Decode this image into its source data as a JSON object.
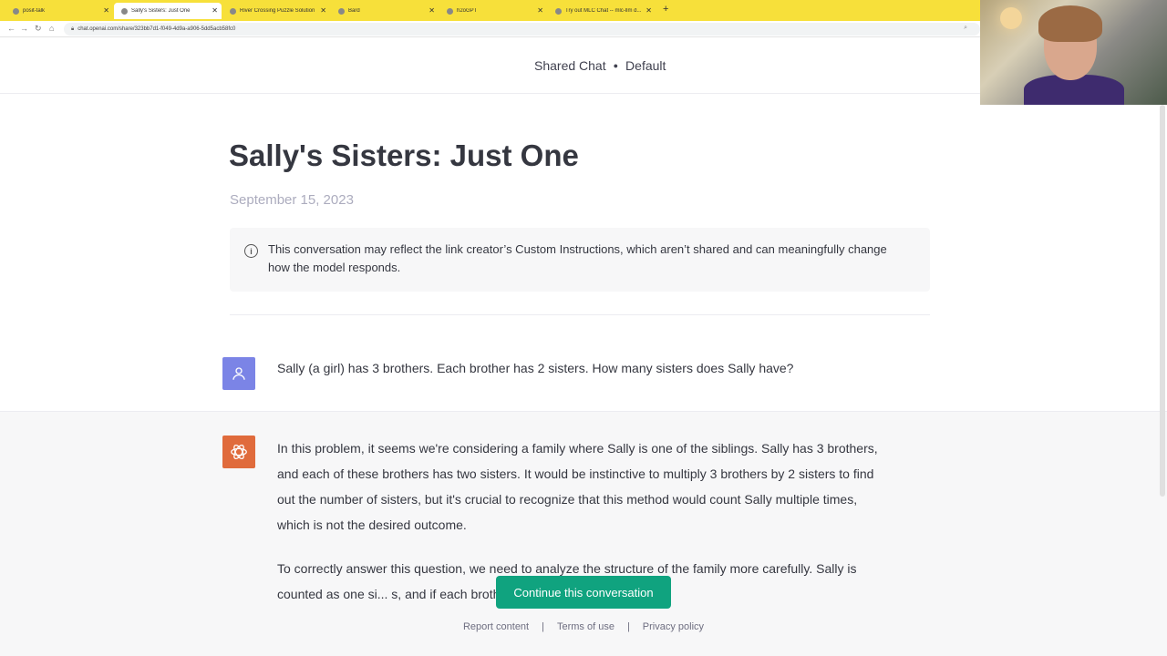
{
  "browser": {
    "tabs": [
      {
        "title": "posit-talk"
      },
      {
        "title": "Sally's Sisters: Just One"
      },
      {
        "title": "River Crossing Puzzle Solution"
      },
      {
        "title": "Bard"
      },
      {
        "title": "h2oGPT"
      },
      {
        "title": "Try out MLC Chat -- mlc-llm d..."
      }
    ],
    "new_tab": "+",
    "url": "chat.openai.com/share/323bb7d1-f049-4d9a-a906-5dd5acb58fc0"
  },
  "header": {
    "shared_chat": "Shared Chat",
    "model": "Default"
  },
  "conversation": {
    "title": "Sally's Sisters: Just One",
    "date": "September 15, 2023",
    "notice": "This conversation may reflect the link creator’s Custom Instructions, which aren’t shared and can meaningfully change how the model responds.",
    "user_message": "Sally (a girl) has 3 brothers. Each brother has 2 sisters. How many sisters does Sally have?",
    "assistant_paragraph_1": "In this problem, it seems we're considering a family where Sally is one of the siblings. Sally has 3 brothers, and each of these brothers has two sisters. It would be instinctive to multiply 3 brothers by 2 sisters to find out the number of sisters, but it's crucial to recognize that this method would count Sally multiple times, which is not the desired outcome.",
    "assistant_paragraph_2": "To correctly answer this question, we need to analyze the structure of the family more carefully. Sally is counted as one si... s, and if each brother has 2"
  },
  "actions": {
    "continue": "Continue this conversation"
  },
  "footer": {
    "report": "Report content",
    "sep1": "|",
    "terms": "Terms of use",
    "sep2": "|",
    "privacy": "Privacy policy"
  },
  "colors": {
    "tabbar": "#f7e03a",
    "user_avatar": "#7b84e6",
    "gpt_avatar": "#e06b3c",
    "continue_button": "#10a37f"
  }
}
